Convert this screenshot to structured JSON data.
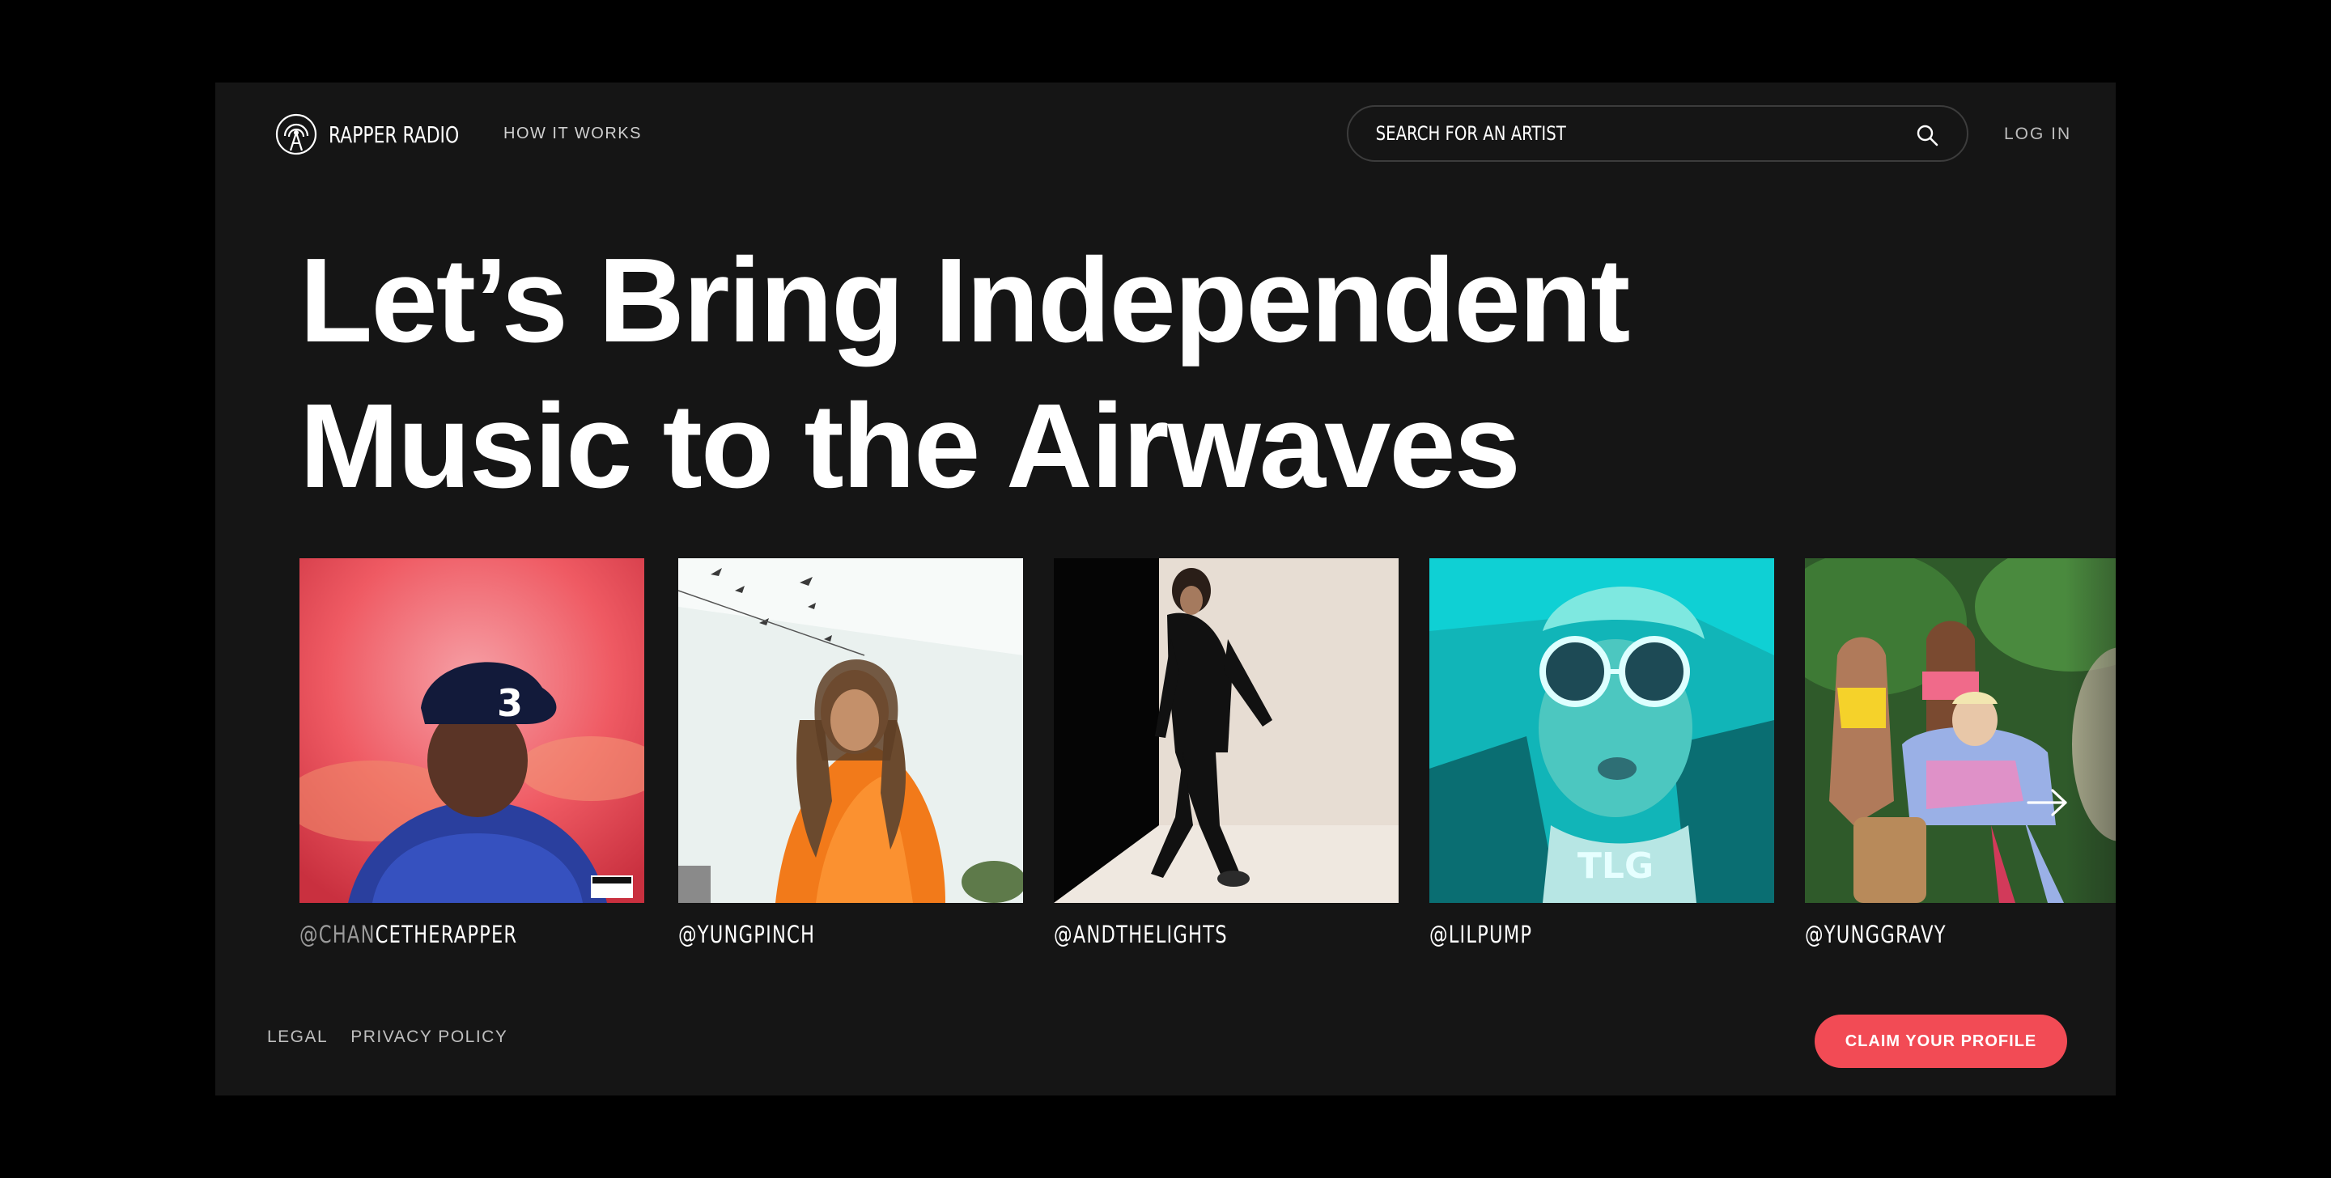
{
  "brand": {
    "name": "RAPPER RADIO",
    "icon": "radio-tower-icon"
  },
  "nav": {
    "how_it_works": "HOW IT WORKS",
    "login": "LOG IN"
  },
  "search": {
    "placeholder": "SEARCH FOR AN ARTIST",
    "value": "",
    "icon": "search-icon"
  },
  "hero": {
    "line1": "Let’s Bring Independent",
    "line2": "Music to the Airwaves"
  },
  "artists": [
    {
      "handle_dim": "@CHAN",
      "handle": "CETHERAPPER"
    },
    {
      "handle": "@YUNGPINCH"
    },
    {
      "handle": "@ANDTHELIGHTS"
    },
    {
      "handle": "@LILPUMP"
    },
    {
      "handle": "@YUNGGRAVY"
    }
  ],
  "carousel": {
    "next_icon": "arrow-right-icon"
  },
  "footer": {
    "legal": "LEGAL",
    "privacy": "PRIVACY POLICY",
    "cta": "CLAIM YOUR PROFILE"
  },
  "colors": {
    "background": "#000000",
    "panel": "#151515",
    "accent": "#f24b55",
    "text": "#ffffff"
  }
}
